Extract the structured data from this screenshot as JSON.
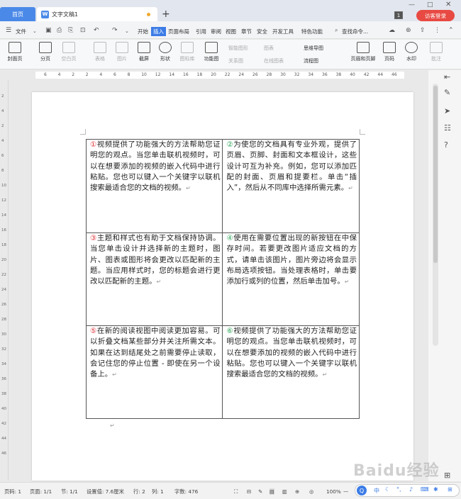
{
  "titlebar": {
    "home_tab": "首页",
    "doc_tab": "文字文稿1",
    "window_number": "1",
    "visitor_login": "访客登录"
  },
  "menu": {
    "file": "文件",
    "items": [
      "开始",
      "插入",
      "页面布局",
      "引用",
      "审阅",
      "视图",
      "章节",
      "安全",
      "开发工具",
      "特色功能"
    ],
    "active": "插入",
    "search": "查找命令..."
  },
  "toolbar": {
    "cover": "封面页",
    "page_break": "分页",
    "blank_page": "空白页",
    "table": "表格",
    "picture": "图片",
    "screenshot": "截屏",
    "shape": "形状",
    "icon_lib": "图标库",
    "function_chart": "功能图",
    "smart_shape": "智能图形",
    "chart": "图表",
    "relation": "关系图",
    "online_chart": "在线图表",
    "mind_map": "思维导图",
    "flowchart": "流程图",
    "header_footer": "页眉和页脚",
    "page_number": "页码",
    "watermark": "水印",
    "comment": "批注"
  },
  "ruler_numbers": [
    "6",
    "4",
    "2",
    "2",
    "4",
    "6",
    "8",
    "10",
    "12",
    "14",
    "16",
    "18",
    "20",
    "22",
    "24",
    "26",
    "28",
    "30",
    "32",
    "34",
    "36",
    "38",
    "40",
    "42",
    "44",
    "46"
  ],
  "vruler_numbers": [
    "2",
    "4",
    "2",
    "4",
    "6",
    "8",
    "10",
    "12",
    "14",
    "16",
    "18",
    "20",
    "22",
    "24",
    "26",
    "28",
    "30",
    "32",
    "34",
    "36",
    "38",
    "40",
    "42",
    "44",
    "46"
  ],
  "document": {
    "cells": [
      {
        "num": "①",
        "text": "视频提供了功能强大的方法帮助您证明您的观点。当您单击联机视频时，可以在想要添加的视频的嵌入代码中进行粘贴。您也可以键入一个关键字以联机搜索最适合您的文档的视频。"
      },
      {
        "num": "②",
        "text": "为使您的文档具有专业外观，提供了页眉、页脚、封面和文本框设计，这些设计可互为补充。例如，您可以添加匹配的封面、页眉和提要栏。单击“插入”，然后从不同库中选择所需元素。"
      },
      {
        "num": "③",
        "text": "主题和样式也有助于文档保持协调。当您单击设计并选择新的主题时，图片、图表或图形将会更改以匹配新的主题。当应用样式时，您的标题会进行更改以匹配新的主题。"
      },
      {
        "num": "④",
        "text": "使用在需要位置出现的新按钮在中保存时间。若要更改图片适应文档的方式，请单击该图片，图片旁边将会显示布局选项按钮。当处理表格时，单击要添加行或列的位置，然后单击加号。"
      },
      {
        "num": "⑤",
        "text": "在新的阅读视图中阅读更加容易。可以折叠文档某些部分并关注所需文本。如果在达到结尾处之前需要停止读取，会记住您的停止位置 - 即使在另一个设备上。"
      },
      {
        "num": "⑥",
        "text": "视频提供了功能强大的方法帮助您证明您的观点。当您单击联机视频时，可以在想要添加的视频的嵌入代码中进行粘贴。您也可以键入一个关键字以联机搜索最适合您的文档的视频。"
      }
    ],
    "para_mark": "↵"
  },
  "statusbar": {
    "page_num": "页码: 1",
    "page_count": "页面: 1/1",
    "section": "节: 1/1",
    "setting": "设置值: 7.6厘米",
    "row": "行: 2",
    "col": "列: 1",
    "word_count": "字数: 476",
    "zoom": "100%"
  },
  "ime": {
    "label": "中"
  },
  "watermark": "Baidu经验",
  "colors": {
    "accent": "#3c7ce6",
    "visitor": "#e84a43",
    "num_red": "#e0363a",
    "num_green": "#2ea65a"
  }
}
